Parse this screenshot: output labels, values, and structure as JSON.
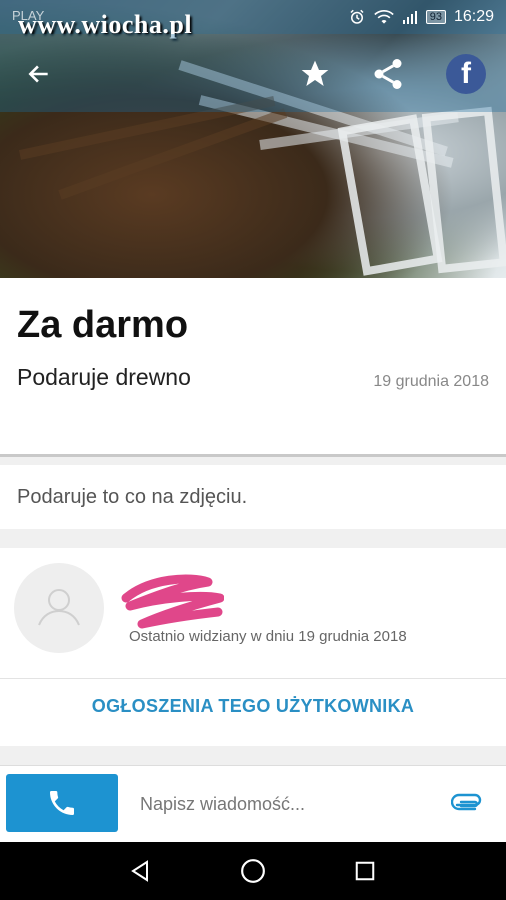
{
  "status_bar": {
    "carrier": "PLAY",
    "watermark": "www.wiocha.pl",
    "battery": "93",
    "time": "16:29",
    "icons": [
      "alarm-icon",
      "wifi-icon",
      "signal-icon",
      "battery-icon"
    ]
  },
  "toolbar": {
    "back_icon": "arrow-left-icon",
    "favorite_icon": "star-icon",
    "share_icon": "share-icon",
    "facebook_label": "f"
  },
  "listing": {
    "title": "Za darmo",
    "subtitle": "Podaruje drewno",
    "date": "19 grudnia 2018",
    "description": "Podaruje to co na zdjęciu."
  },
  "user": {
    "last_seen": "Ostatnio widziany w dniu 19 grudnia 2018",
    "ads_link": "OGŁOSZENIA TEGO UŻYTKOWNIKA"
  },
  "message_bar": {
    "placeholder": "Napisz wiadomość...",
    "call_icon": "phone-icon",
    "attach_icon": "paperclip-icon"
  },
  "nav": {
    "icons": [
      "back-triangle-icon",
      "home-circle-icon",
      "recents-square-icon"
    ]
  },
  "colors": {
    "accent": "#1d93d1",
    "link": "#2a8fc4",
    "scribble": "#e0478a",
    "facebook": "#3b5998"
  }
}
